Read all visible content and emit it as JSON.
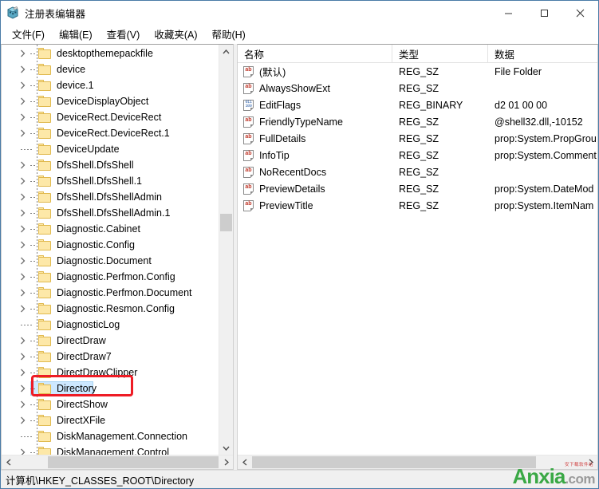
{
  "window": {
    "title": "注册表编辑器",
    "icon": "registry-editor-icon",
    "minimize_label": "—",
    "maximize_label": "□",
    "close_label": "✕"
  },
  "menubar": {
    "items": [
      {
        "label": "文件(F)",
        "name": "menu-file"
      },
      {
        "label": "编辑(E)",
        "name": "menu-edit"
      },
      {
        "label": "查看(V)",
        "name": "menu-view"
      },
      {
        "label": "收藏夹(A)",
        "name": "menu-favorites"
      },
      {
        "label": "帮助(H)",
        "name": "menu-help"
      }
    ]
  },
  "tree": {
    "items": [
      {
        "label": "desktopthemepackfile",
        "expandable": true,
        "selected": false
      },
      {
        "label": "device",
        "expandable": true,
        "selected": false
      },
      {
        "label": "device.1",
        "expandable": true,
        "selected": false
      },
      {
        "label": "DeviceDisplayObject",
        "expandable": true,
        "selected": false
      },
      {
        "label": "DeviceRect.DeviceRect",
        "expandable": true,
        "selected": false
      },
      {
        "label": "DeviceRect.DeviceRect.1",
        "expandable": true,
        "selected": false
      },
      {
        "label": "DeviceUpdate",
        "expandable": false,
        "selected": false
      },
      {
        "label": "DfsShell.DfsShell",
        "expandable": true,
        "selected": false
      },
      {
        "label": "DfsShell.DfsShell.1",
        "expandable": true,
        "selected": false
      },
      {
        "label": "DfsShell.DfsShellAdmin",
        "expandable": true,
        "selected": false
      },
      {
        "label": "DfsShell.DfsShellAdmin.1",
        "expandable": true,
        "selected": false
      },
      {
        "label": "Diagnostic.Cabinet",
        "expandable": true,
        "selected": false
      },
      {
        "label": "Diagnostic.Config",
        "expandable": true,
        "selected": false
      },
      {
        "label": "Diagnostic.Document",
        "expandable": true,
        "selected": false
      },
      {
        "label": "Diagnostic.Perfmon.Config",
        "expandable": true,
        "selected": false
      },
      {
        "label": "Diagnostic.Perfmon.Document",
        "expandable": true,
        "selected": false
      },
      {
        "label": "Diagnostic.Resmon.Config",
        "expandable": true,
        "selected": false
      },
      {
        "label": "DiagnosticLog",
        "expandable": false,
        "selected": false
      },
      {
        "label": "DirectDraw",
        "expandable": true,
        "selected": false
      },
      {
        "label": "DirectDraw7",
        "expandable": true,
        "selected": false
      },
      {
        "label": "DirectDrawClipper",
        "expandable": true,
        "selected": false
      },
      {
        "label": "Directory",
        "expandable": true,
        "selected": true
      },
      {
        "label": "DirectShow",
        "expandable": true,
        "selected": false
      },
      {
        "label": "DirectXFile",
        "expandable": true,
        "selected": false
      },
      {
        "label": "DiskManagement.Connection",
        "expandable": false,
        "selected": false
      },
      {
        "label": "DiskManagement.Control",
        "expandable": true,
        "selected": false
      }
    ]
  },
  "values": {
    "columns": [
      "名称",
      "类型",
      "数据"
    ],
    "rows": [
      {
        "icon": "string-value-icon",
        "name": "(默认)",
        "type": "REG_SZ",
        "data": "File Folder"
      },
      {
        "icon": "string-value-icon",
        "name": "AlwaysShowExt",
        "type": "REG_SZ",
        "data": ""
      },
      {
        "icon": "binary-value-icon",
        "name": "EditFlags",
        "type": "REG_BINARY",
        "data": "d2 01 00 00"
      },
      {
        "icon": "string-value-icon",
        "name": "FriendlyTypeName",
        "type": "REG_SZ",
        "data": "@shell32.dll,-10152"
      },
      {
        "icon": "string-value-icon",
        "name": "FullDetails",
        "type": "REG_SZ",
        "data": "prop:System.PropGrou"
      },
      {
        "icon": "string-value-icon",
        "name": "InfoTip",
        "type": "REG_SZ",
        "data": "prop:System.Comment"
      },
      {
        "icon": "string-value-icon",
        "name": "NoRecentDocs",
        "type": "REG_SZ",
        "data": ""
      },
      {
        "icon": "string-value-icon",
        "name": "PreviewDetails",
        "type": "REG_SZ",
        "data": "prop:System.DateMod"
      },
      {
        "icon": "string-value-icon",
        "name": "PreviewTitle",
        "type": "REG_SZ",
        "data": "prop:System.ItemNam"
      }
    ]
  },
  "statusbar": {
    "path": "计算机\\HKEY_CLASSES_ROOT\\Directory"
  },
  "annotation": {
    "shape": "red-rounded-rectangle",
    "target": "Directory",
    "color": "#ee1c25"
  },
  "watermark": {
    "main": "Anxia",
    "suffix": ".com",
    "sub": "安下载软件站",
    "main_color": "#3aa845",
    "suffix_color": "#9a9a9a"
  },
  "scrollbars": {
    "tree_up_arrow": "▲",
    "tree_down_arrow": "▼",
    "left_arrow": "‹",
    "right_arrow": "›"
  }
}
